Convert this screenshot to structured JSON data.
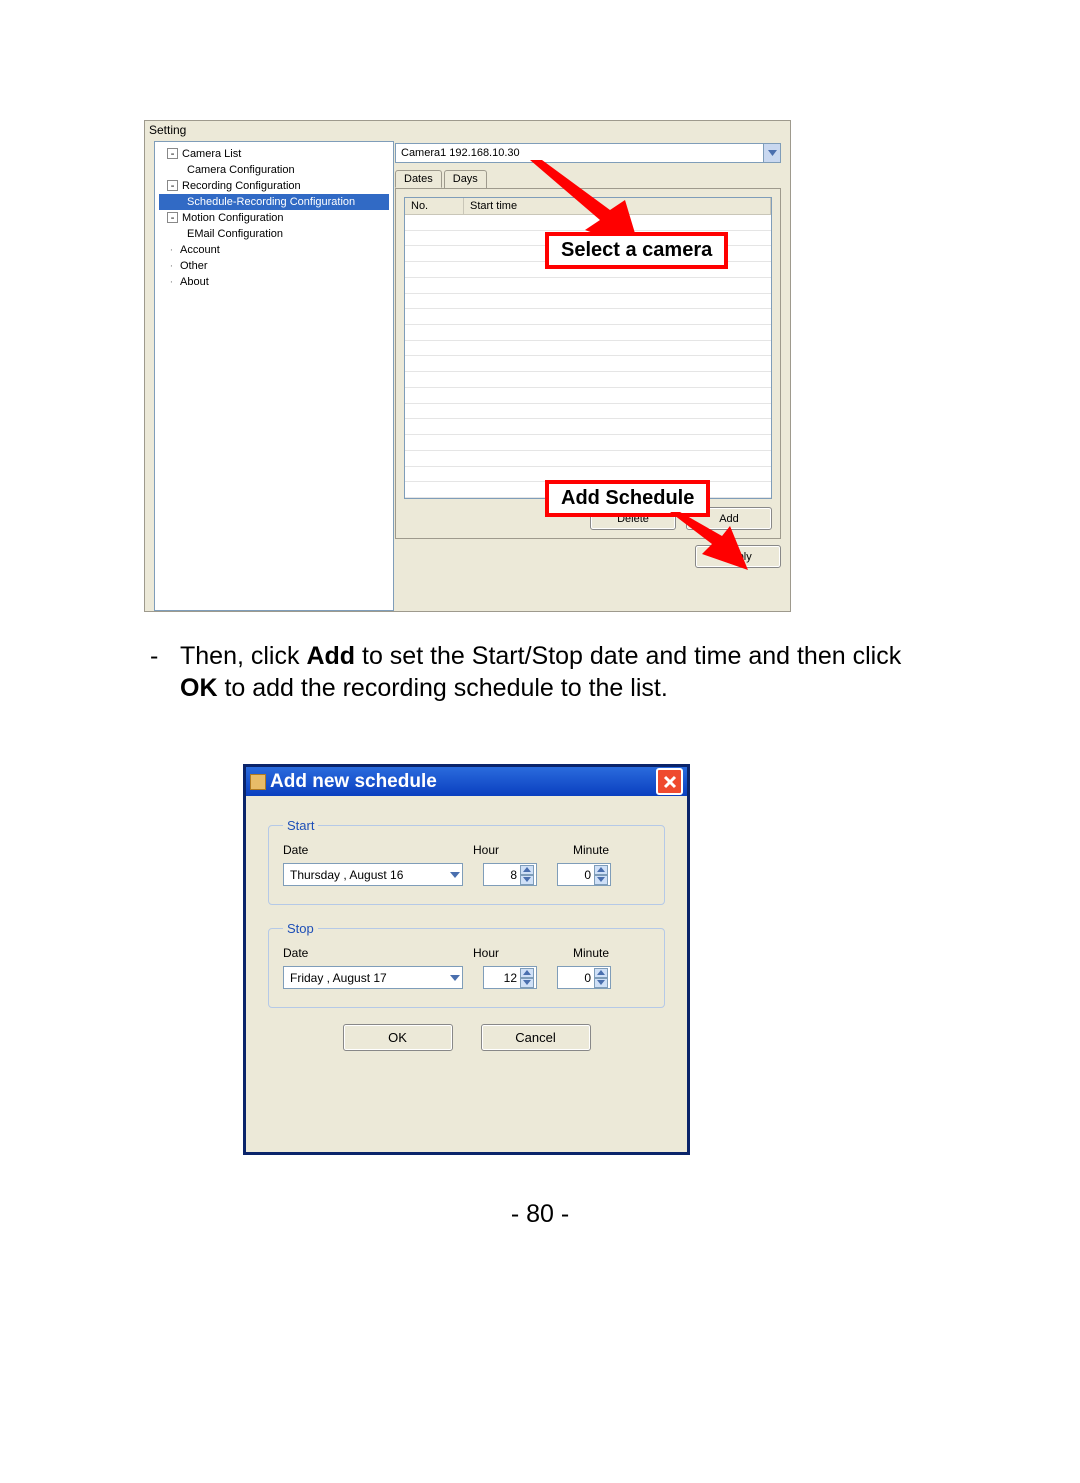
{
  "win1": {
    "title": "Setting",
    "tree": [
      {
        "lvl": 1,
        "exp": "-",
        "label": "Camera List"
      },
      {
        "lvl": 2,
        "exp": "",
        "label": "Camera Configuration"
      },
      {
        "lvl": 1,
        "exp": "-",
        "label": "Recording Configuration"
      },
      {
        "lvl": 2,
        "exp": "",
        "label": "Schedule-Recording Configuration",
        "sel": true
      },
      {
        "lvl": 1,
        "exp": "-",
        "label": "Motion Configuration"
      },
      {
        "lvl": 2,
        "exp": "",
        "label": "EMail Configuration"
      },
      {
        "lvl": 1,
        "exp": "",
        "label": "Account"
      },
      {
        "lvl": 1,
        "exp": "",
        "label": "Other"
      },
      {
        "lvl": 1,
        "exp": "",
        "label": "About"
      }
    ],
    "camera_selected": "Camera1 192.168.10.30",
    "tabs": [
      "Dates",
      "Days"
    ],
    "active_tab": 0,
    "grid_cols": [
      "No.",
      "Start time"
    ],
    "buttons": {
      "delete": "Delete",
      "add": "Add",
      "apply": "Apply"
    }
  },
  "callouts": {
    "select_camera": "Select a camera",
    "add_schedule": "Add Schedule"
  },
  "instruction": {
    "pre": "Then, click ",
    "b1": "Add",
    "mid1": " to set the Start/Stop date and time and then click ",
    "b2": "OK",
    "mid2": " to add the recording schedule to the list."
  },
  "dlg": {
    "title": "Add new schedule",
    "start_legend": "Start",
    "stop_legend": "Stop",
    "labels": {
      "date": "Date",
      "hour": "Hour",
      "minute": "Minute"
    },
    "start": {
      "date": "Thursday ,   August   16",
      "hour": "8",
      "minute": "0"
    },
    "stop": {
      "date": "Friday     ,   August   17",
      "hour": "12",
      "minute": "0"
    },
    "ok": "OK",
    "cancel": "Cancel"
  },
  "page_number": "- 80 -"
}
